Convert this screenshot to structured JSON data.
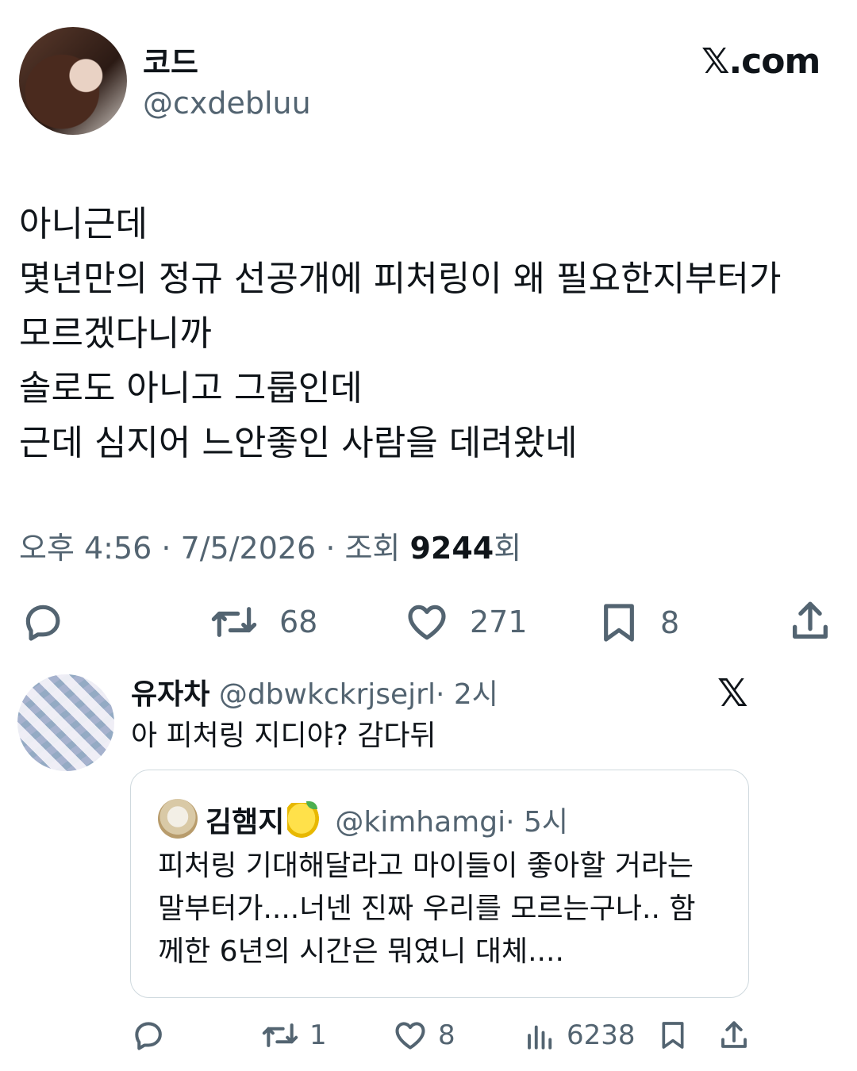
{
  "author": {
    "name": "코드",
    "handle": "@cxdebluu"
  },
  "brand": "𝕏.com",
  "tweet": {
    "lines": [
      "아니근데",
      "몇년만의 정규 선공개에 피처링이 왜 필요한지부터가",
      "모르겠다니까",
      "솔로도 아니고 그룹인데",
      "근데 심지어 느안좋인 사람을 데려왔네"
    ],
    "meta_prefix": "오후 4:56 · 7/5/2026 · 조회 ",
    "views": "9244",
    "views_suffix": "회"
  },
  "actions": {
    "reply_icon": "reply-icon",
    "retweet_count": "68",
    "like_count": "271",
    "bookmark_count": "8",
    "share_icon": "share-icon"
  },
  "reply": {
    "name": "유자차",
    "handle": "@dbwkckrjsejrl",
    "time": "· 2시",
    "x_mark": "𝕏",
    "text": "아 피처링 지디야? 감다뒤",
    "quote": {
      "name": "김햄지",
      "emoji": "lemon",
      "handle": "@kimhamgi",
      "time": "· 5시",
      "lines": [
        "피처링 기대해달라고 마이들이 좋아할 거라는",
        "말부터가....너넨 진짜 우리를 모르는구나.. 함",
        "께한 6년의 시간은 뭐였니 대체...."
      ]
    },
    "actions": {
      "retweet_count": "1",
      "like_count": "8",
      "views_count": "6238"
    }
  },
  "colors": {
    "text": "#0f1419",
    "secondary": "#536471",
    "border": "#cfd9de"
  }
}
